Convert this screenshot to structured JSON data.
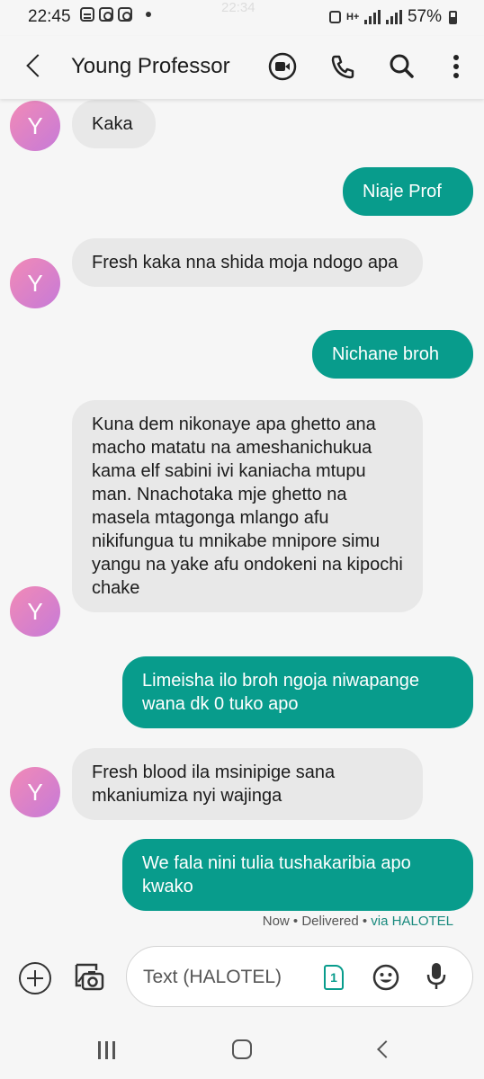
{
  "status_bar": {
    "time": "22:45",
    "ghost_time": "22:34",
    "network_type": "H+",
    "battery": "57%"
  },
  "header": {
    "contact_name": "Young Professor",
    "icons": [
      "back-icon",
      "video-call-icon",
      "phone-icon",
      "search-icon",
      "more-icon"
    ]
  },
  "avatar_letter": "Y",
  "messages": [
    {
      "direction": "in",
      "text": "Kaka"
    },
    {
      "direction": "out",
      "text": "Niaje Prof"
    },
    {
      "direction": "in",
      "text": "Fresh kaka nna shida moja ndogo apa"
    },
    {
      "direction": "out",
      "text": "Nichane broh"
    },
    {
      "direction": "in",
      "text": "Kuna dem nikonaye apa ghetto ana macho matatu na ameshanichukua kama elf sabini ivi kaniacha mtupu man. Nnachotaka mje ghetto na masela mtagonga mlango afu nikifungua tu mnikabe mnipore simu yangu na yake afu ondokeni na kipochi chake"
    },
    {
      "direction": "out",
      "text": "Limeisha ilo broh ngoja niwapange wana dk 0 tuko apo"
    },
    {
      "direction": "in",
      "text": "Fresh blood ila msinipige sana mkaniumiza nyi wajinga"
    },
    {
      "direction": "out",
      "text": "We fala nini tulia tushakaribia apo kwako"
    }
  ],
  "delivery": {
    "status": "Now • Delivered • ",
    "carrier": "via HALOTEL"
  },
  "composer": {
    "placeholder": "Text (HALOTEL)",
    "sim_number": "1"
  },
  "colors": {
    "accent": "#089c8c",
    "incoming_bubble": "#e8e8e8",
    "avatar_gradient_start": "#f28ab6",
    "avatar_gradient_end": "#c67ad8",
    "background": "#f6f6f6"
  }
}
